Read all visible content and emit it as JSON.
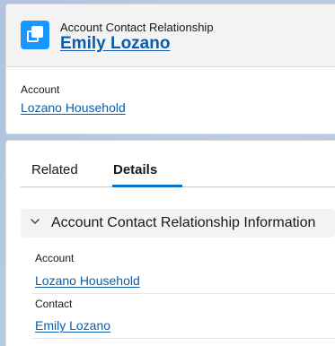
{
  "header": {
    "object_label": "Account Contact Relationship",
    "record_name": "Emily Lozano",
    "icon": "account-contact-relationship-icon",
    "icon_color": "#1b96ff",
    "highlights": {
      "account_label": "Account",
      "account_value": "Lozano Household"
    }
  },
  "tabs": [
    {
      "label": "Related",
      "active": false
    },
    {
      "label": "Details",
      "active": true
    }
  ],
  "section": {
    "title": "Account Contact Relationship Information",
    "icon": "chevron-down-icon",
    "fields": [
      {
        "label": "Account",
        "value": "Lozano Household"
      },
      {
        "label": "Contact",
        "value": "Emily Lozano"
      }
    ]
  },
  "colors": {
    "link": "#0b5cab",
    "active_tab": "#0176d3",
    "background": "#b0c4df"
  }
}
